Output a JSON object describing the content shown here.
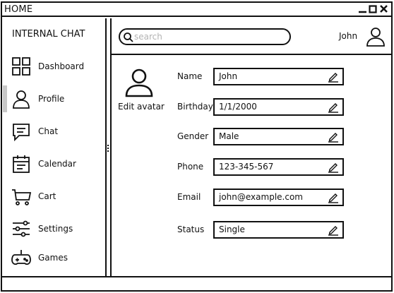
{
  "window": {
    "title": "HOME",
    "controls": [
      "minimize-icon",
      "maximize-icon",
      "close-icon"
    ]
  },
  "sidebar": {
    "app_title": "INTERNAL CHAT",
    "items": [
      {
        "label": "Dashboard",
        "icon": "dashboard-grid-icon",
        "active": false
      },
      {
        "label": "Profile",
        "icon": "user-icon",
        "active": true
      },
      {
        "label": "Chat",
        "icon": "chat-bubble-icon",
        "active": false
      },
      {
        "label": "Calendar",
        "icon": "calendar-icon",
        "active": false
      },
      {
        "label": "Cart",
        "icon": "cart-icon",
        "active": false
      },
      {
        "label": "Settings",
        "icon": "sliders-icon",
        "active": false
      },
      {
        "label": "Games",
        "icon": "gamepad-icon",
        "active": false
      }
    ]
  },
  "header": {
    "search": {
      "placeholder": "search",
      "value": ""
    },
    "user_name": "John"
  },
  "profile": {
    "edit_avatar_label": "Edit avatar",
    "fields": [
      {
        "label": "Name",
        "value": "John"
      },
      {
        "label": "Birthday",
        "value": "1/1/2000"
      },
      {
        "label": "Gender",
        "value": "Male"
      },
      {
        "label": "Phone",
        "value": "123-345-567"
      },
      {
        "label": "Email",
        "value": "john@example.com"
      },
      {
        "label": "Status",
        "value": "Single"
      }
    ]
  }
}
